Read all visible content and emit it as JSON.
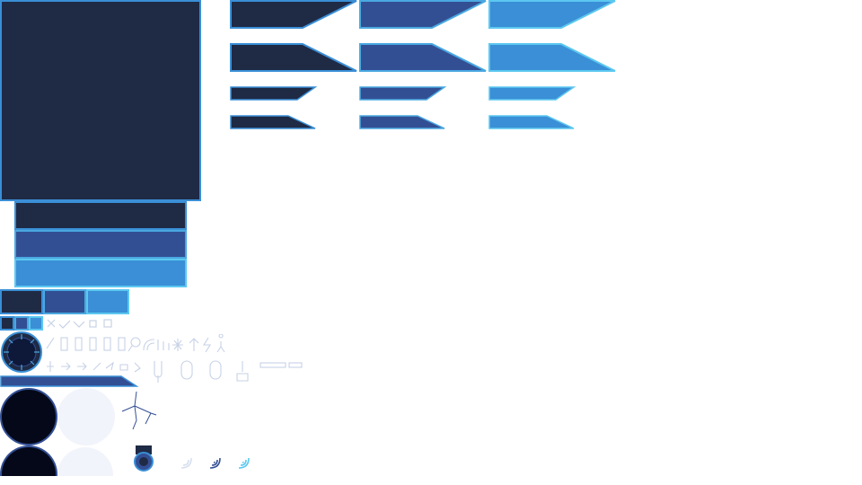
{
  "sheet": {
    "colors": {
      "dark": "#1f2a45",
      "mid": "#334f94",
      "light": "#3a8fd6",
      "border": "#3a8fd6",
      "border_light": "#5cc8f0",
      "black": "#040818",
      "pale": "#f2f4fb"
    },
    "icons": [
      "cross-icon",
      "check-icon",
      "chevron-down-icon",
      "heart-icon",
      "gear-icon",
      "battery-icon",
      "search-icon",
      "signal-icon",
      "snowflake-icon",
      "arrow-up-icon",
      "lightning-icon",
      "person-icon",
      "sword-icon",
      "arrow-right-icon",
      "fist-icon",
      "microphone-icon",
      "mouse-icon",
      "joystick-icon",
      "slider-icon",
      "radial-dial-icon",
      "crack-icon",
      "pin-icon",
      "wifi-icon"
    ]
  }
}
